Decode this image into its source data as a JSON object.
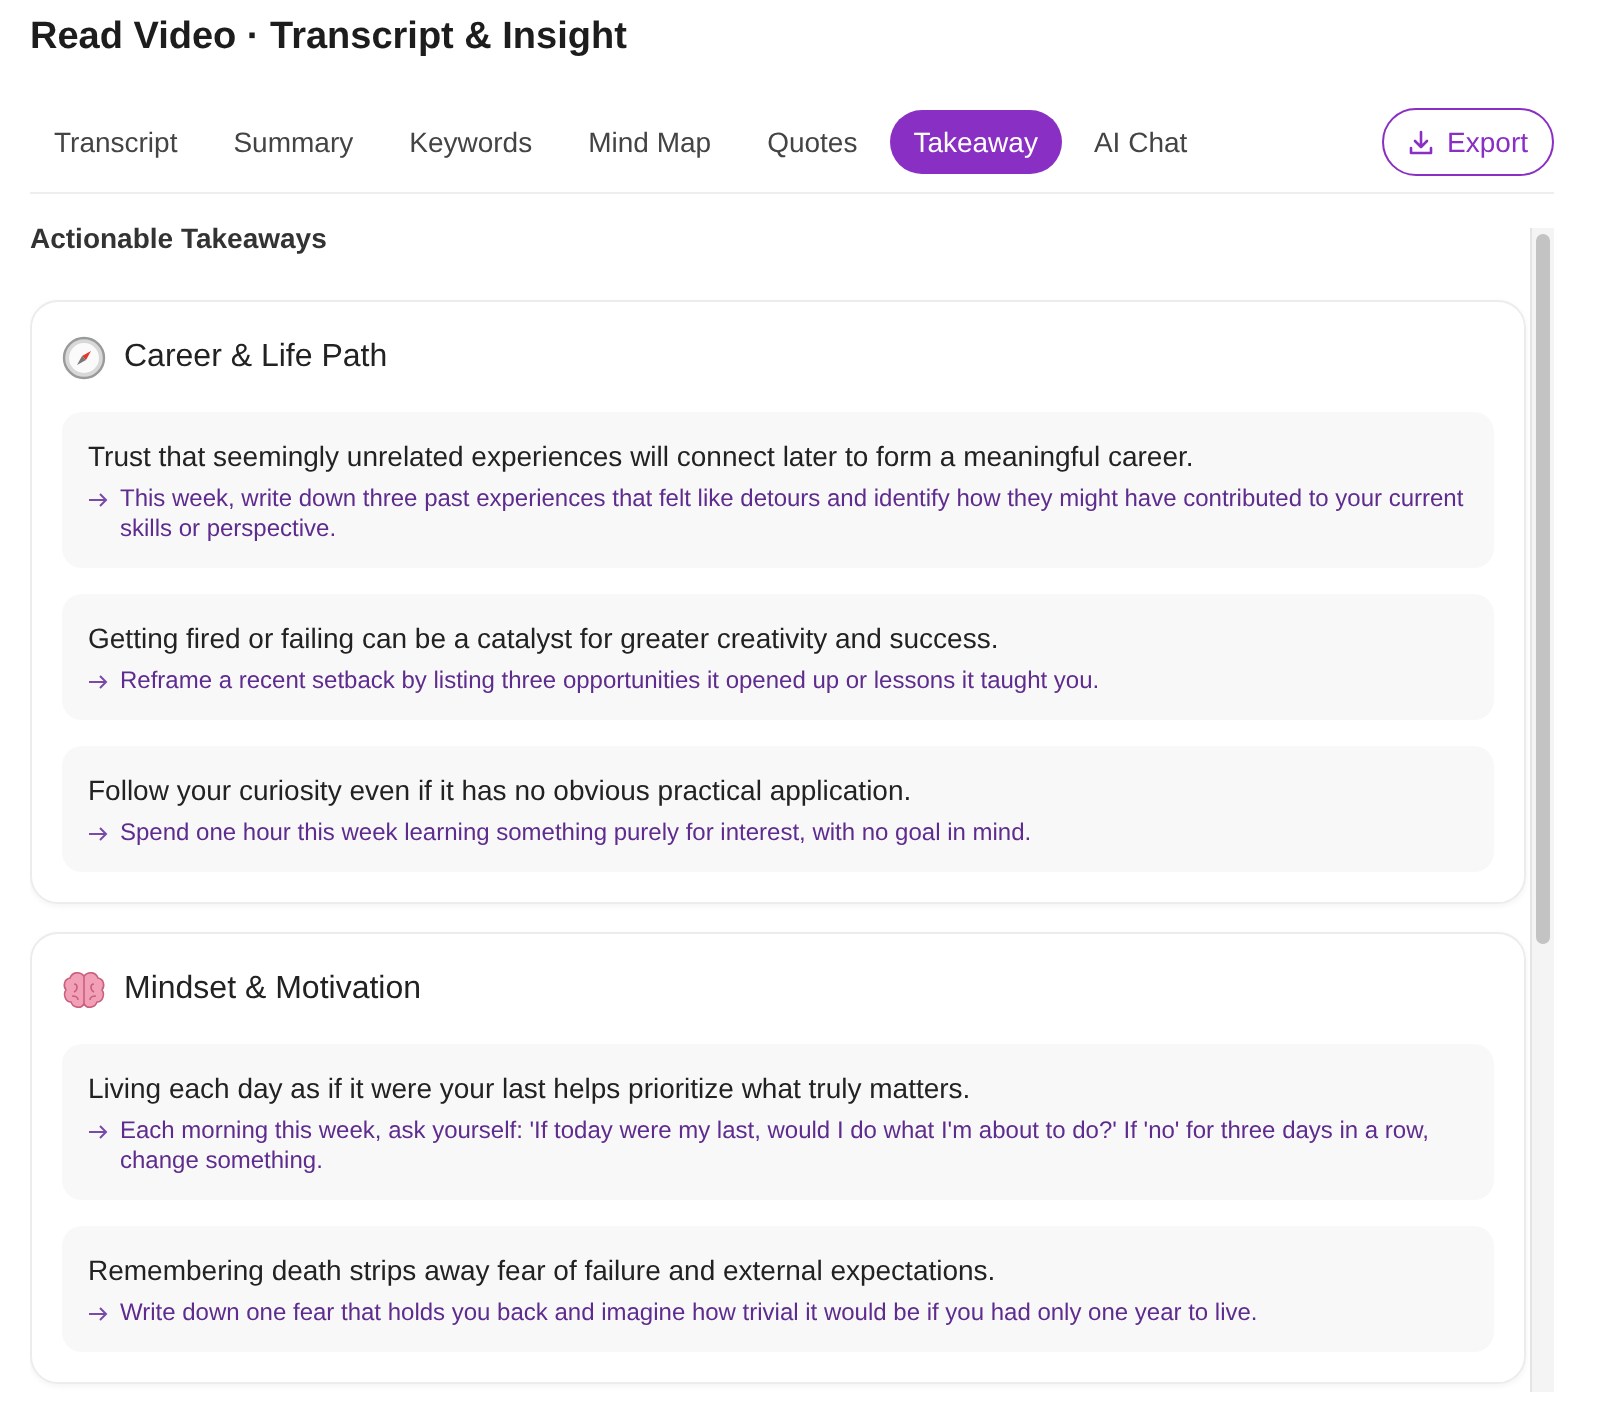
{
  "title": "Read Video · Transcript & Insight",
  "tabs": [
    {
      "label": "Transcript",
      "selected": false
    },
    {
      "label": "Summary",
      "selected": false
    },
    {
      "label": "Keywords",
      "selected": false
    },
    {
      "label": "Mind Map",
      "selected": false
    },
    {
      "label": "Quotes",
      "selected": false
    },
    {
      "label": "Takeaway",
      "selected": true
    },
    {
      "label": "AI Chat",
      "selected": false
    }
  ],
  "export_button": "Export",
  "panel_heading": "Actionable Takeaways",
  "sections": [
    {
      "title": "Career & Life Path",
      "items": [
        {
          "insight": "Trust that seemingly unrelated experiences will connect later to form a meaningful career.",
          "action": "This week, write down three past experiences that felt like detours and identify how they might have contributed to your current skills or perspective."
        },
        {
          "insight": "Getting fired or failing can be a catalyst for greater creativity and success.",
          "action": "Reframe a recent setback by listing three opportunities it opened up or lessons it taught you."
        },
        {
          "insight": "Follow your curiosity even if it has no obvious practical application.",
          "action": "Spend one hour this week learning something purely for interest, with no goal in mind."
        }
      ]
    },
    {
      "title": "Mindset & Motivation",
      "items": [
        {
          "insight": "Living each day as if it were your last helps prioritize what truly matters.",
          "action": "Each morning this week, ask yourself: 'If today were my last, would I do what I'm about to do?' If 'no' for three days in a row, change something."
        },
        {
          "insight": "Remembering death strips away fear of failure and external expectations.",
          "action": "Write down one fear that holds you back and imagine how trivial it would be if you had only one year to live."
        }
      ]
    }
  ]
}
